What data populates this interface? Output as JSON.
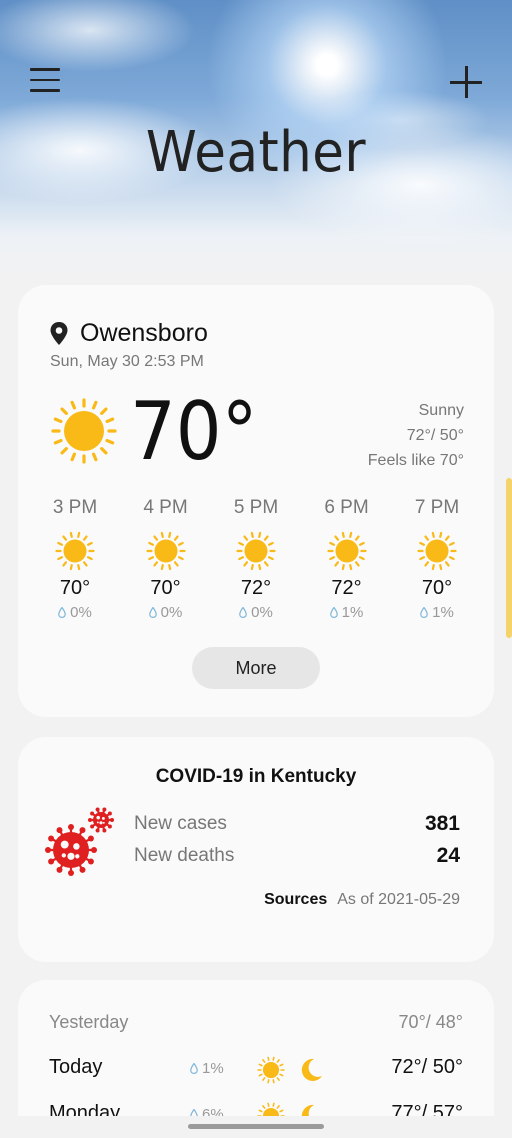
{
  "header": {
    "title": "Weather",
    "menu_icon": "hamburger-menu-icon",
    "add_icon": "plus-icon"
  },
  "current": {
    "location": "Owensboro",
    "datetime": "Sun, May 30 2:53 PM",
    "temp": "70°",
    "condition": "Sunny",
    "high_low": "72°/ 50°",
    "feels_like": "Feels like 70°",
    "icon": "sun-icon"
  },
  "hourly": [
    {
      "time": "3 PM",
      "temp": "70°",
      "precip": "0%"
    },
    {
      "time": "4 PM",
      "temp": "70°",
      "precip": "0%"
    },
    {
      "time": "5 PM",
      "temp": "72°",
      "precip": "0%"
    },
    {
      "time": "6 PM",
      "temp": "72°",
      "precip": "1%"
    },
    {
      "time": "7 PM",
      "temp": "70°",
      "precip": "1%"
    }
  ],
  "more_label": "More",
  "covid": {
    "title": "COVID-19 in Kentucky",
    "new_cases_label": "New cases",
    "new_cases_value": "381",
    "new_deaths_label": "New deaths",
    "new_deaths_value": "24",
    "sources_label": "Sources",
    "as_of": "As of 2021-05-29"
  },
  "daily": [
    {
      "day": "Yesterday",
      "range": "70°/ 48°"
    },
    {
      "day": "Today",
      "precip": "1%",
      "range": "72°/ 50°"
    },
    {
      "day": "Monday",
      "precip": "6%",
      "range": "77°/ 57°"
    }
  ],
  "colors": {
    "sun": "#f9b916",
    "virus": "#e02020",
    "drop": "#7fb6d9",
    "scrollbar": "#f4d36b"
  }
}
